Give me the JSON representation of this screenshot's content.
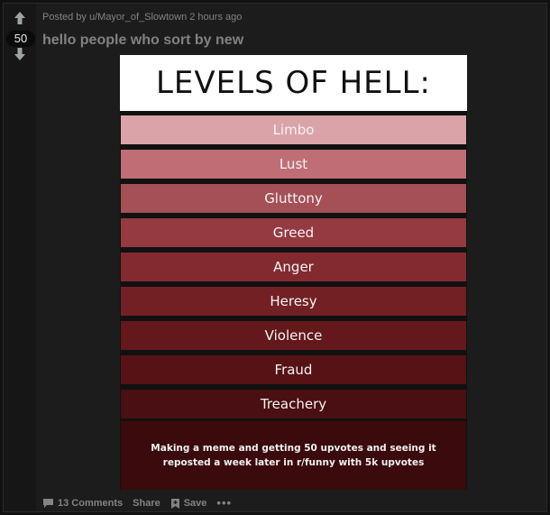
{
  "post": {
    "score": "50",
    "meta": "Posted by u/Mayor_of_Slowtown 2 hours ago",
    "title": "hello people who sort by new"
  },
  "meme": {
    "title": "LEVELS OF HELL:",
    "levels": [
      {
        "label": "Limbo",
        "color": "#d9a3a8"
      },
      {
        "label": "Lust",
        "color": "#bf6e76"
      },
      {
        "label": "Gluttony",
        "color": "#a54f57"
      },
      {
        "label": "Greed",
        "color": "#943a40"
      },
      {
        "label": "Anger",
        "color": "#832a30"
      },
      {
        "label": "Heresy",
        "color": "#732025"
      },
      {
        "label": "Violence",
        "color": "#64181c"
      },
      {
        "label": "Fraud",
        "color": "#561215"
      },
      {
        "label": "Treachery",
        "color": "#4a0f12"
      }
    ],
    "caption": "Making a meme and getting 50 upvotes and seeing it reposted a week later in r/funny with 5k upvotes"
  },
  "actions": {
    "comments": "13 Comments",
    "share": "Share",
    "save": "Save",
    "more": "•••"
  },
  "colors": {
    "background": "#111111",
    "card": "#1c1c1c",
    "muted_text": "#818384"
  },
  "icons": {
    "upvote": "upvote-arrow-icon",
    "downvote": "downvote-arrow-icon",
    "comments": "comment-icon",
    "save": "bookmark-icon"
  }
}
